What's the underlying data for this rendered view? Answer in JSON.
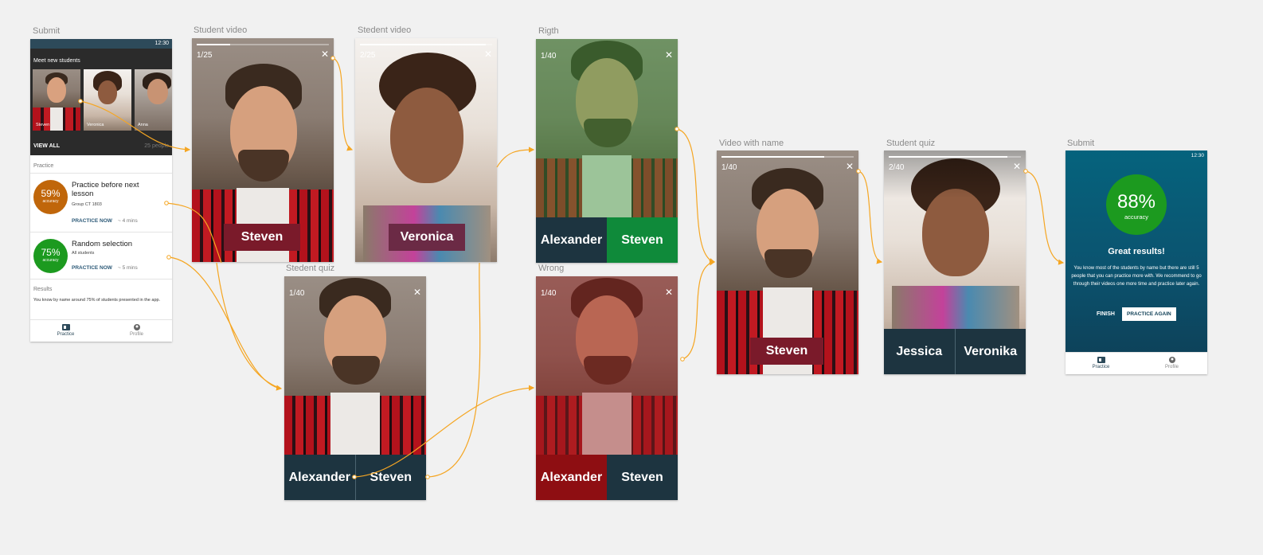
{
  "labels": {
    "submit1": "Submit",
    "video1": "Student video",
    "video2": "Stedent video",
    "right": "Rigth",
    "quiz1": "Stedent quiz",
    "wrong": "Wrong",
    "withname": "Video with name",
    "quiz2": "Student quiz",
    "submit2": "Submit"
  },
  "home": {
    "status_time": "12:30",
    "meet_title": "Meet new students",
    "students": [
      "Steven",
      "Veronica",
      "Anna"
    ],
    "view_all": "VIEW ALL",
    "people_count": "25 people",
    "section_title": "Practice",
    "items": [
      {
        "percent": "59%",
        "accuracy": "accuracy",
        "title": "Practice before next lesson",
        "subtitle": "Group CT 1803",
        "link": "PRACTICE NOW",
        "time": "~ 4 mins",
        "color": "#c0660a"
      },
      {
        "percent": "75%",
        "accuracy": "accuracy",
        "title": "Random selection",
        "subtitle": "All students",
        "link": "PRACTICE NOW",
        "time": "~ 5 mins",
        "color": "#1c9a1f"
      }
    ],
    "results_title": "Results",
    "results_text": "You know by name around 75% of students presented in the app.",
    "nav": [
      "Practice",
      "Profile"
    ]
  },
  "video1": {
    "counter": "1/25",
    "progress": 0.25,
    "name": "Steven",
    "chip_color": "#7a1a2a"
  },
  "video2": {
    "counter": "2/25",
    "progress": 0.95,
    "name": "Veronica",
    "chip_color": "#6b2a45"
  },
  "right": {
    "counter": "1/40",
    "options": [
      "Alexander",
      "Steven"
    ]
  },
  "quiz1": {
    "counter": "1/40",
    "options": [
      "Alexander",
      "Steven"
    ]
  },
  "wrong": {
    "counter": "1/40",
    "options": [
      "Alexander",
      "Steven"
    ]
  },
  "withname": {
    "counter": "1/40",
    "progress": 0.78,
    "name": "Steven",
    "chip_color": "#7a1a2a"
  },
  "quiz2": {
    "counter": "2/40",
    "progress": 0.9,
    "options": [
      "Jessica",
      "Veronika"
    ]
  },
  "final": {
    "status_time": "12:30",
    "percent": "88%",
    "accuracy": "accuracy",
    "headline": "Great results!",
    "message": "You know most of the students by name but there are still 5 people that you can practice more with. We recommend to go through their videos one more time and practice later again.",
    "finish": "FINISH",
    "again": "PRACTICE AGAIN",
    "nav": [
      "Practice",
      "Profile"
    ]
  },
  "colors": {
    "connector": "#f5a623",
    "answer_dark": "#1d3440",
    "right_green": "#0f8a3a",
    "wrong_red": "#8e0e12"
  },
  "icons": [
    "close-icon",
    "wifi-icon",
    "signal-icon",
    "battery-icon",
    "practice-icon",
    "profile-icon"
  ]
}
